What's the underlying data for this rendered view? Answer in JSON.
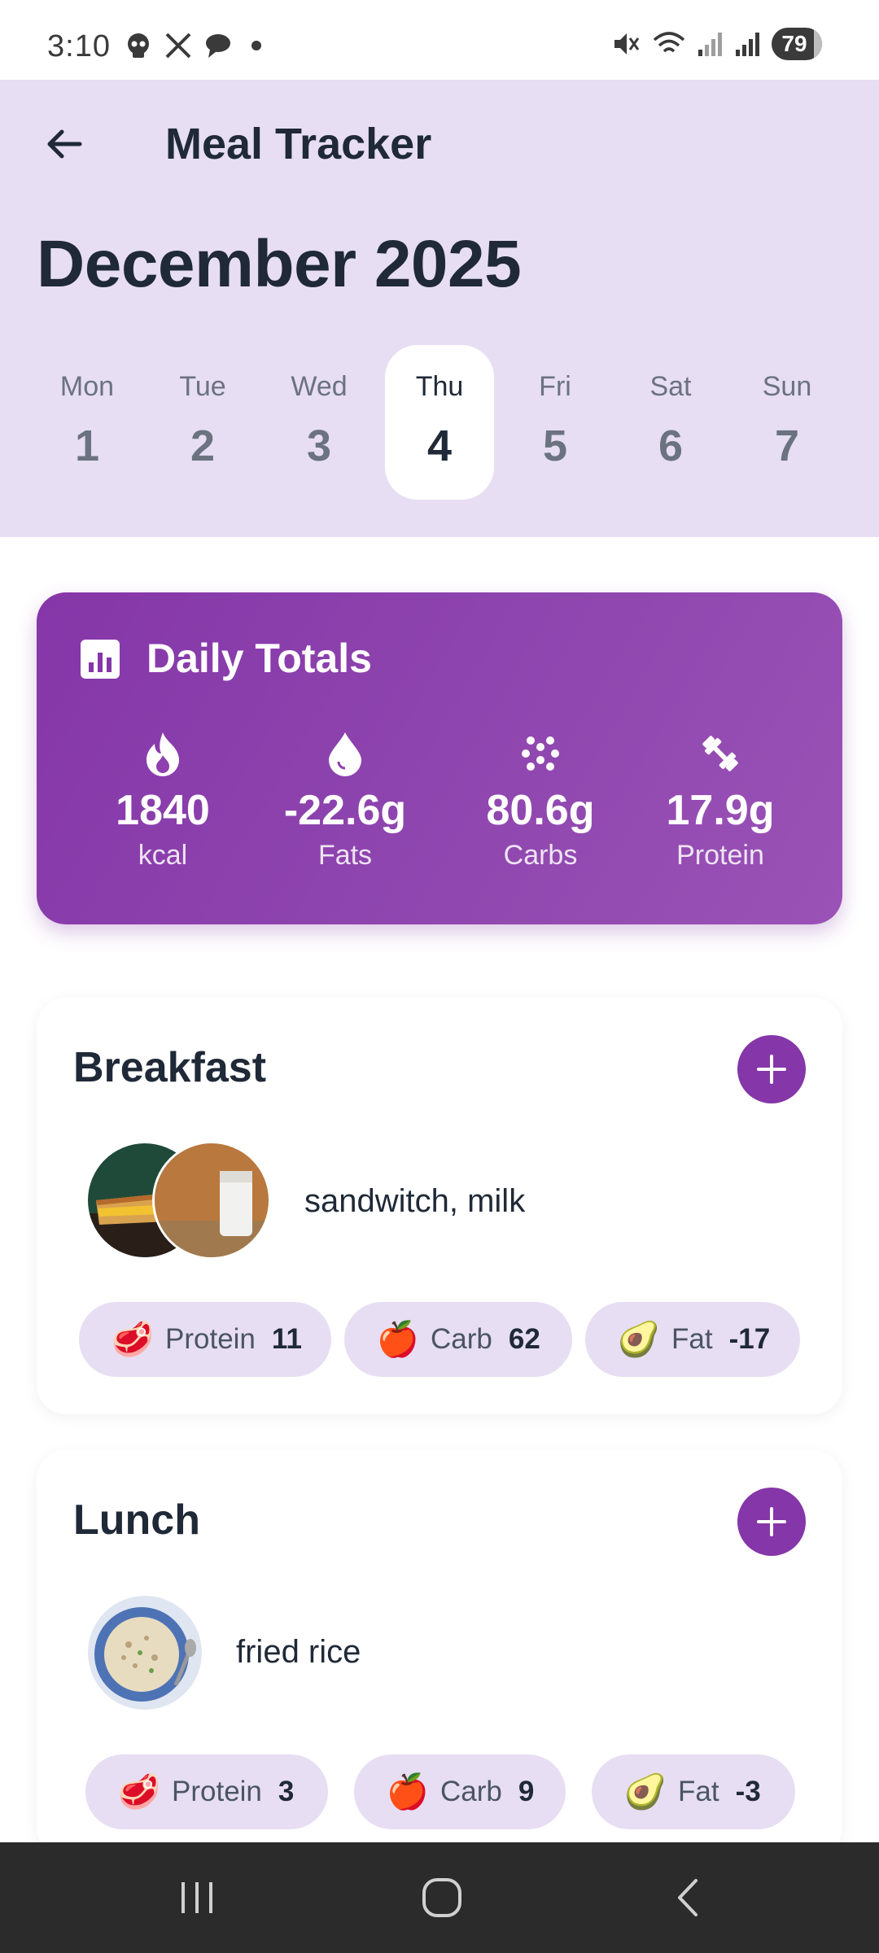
{
  "status_bar": {
    "time": "3:10",
    "battery": "79",
    "left_icons": [
      "skull-icon",
      "x-logo-icon",
      "chat-bubble-icon",
      "dot-icon"
    ],
    "right_icons": [
      "mute-icon",
      "wifi-icon",
      "signal-icon",
      "signal-icon",
      "battery-icon"
    ]
  },
  "header": {
    "title": "Meal Tracker",
    "month": "December 2025",
    "background": "#e7def3"
  },
  "week": {
    "days": [
      {
        "name": "Mon",
        "num": "1"
      },
      {
        "name": "Tue",
        "num": "2"
      },
      {
        "name": "Wed",
        "num": "3"
      },
      {
        "name": "Thu",
        "num": "4",
        "selected": true
      },
      {
        "name": "Fri",
        "num": "5"
      },
      {
        "name": "Sat",
        "num": "6"
      },
      {
        "name": "Sun",
        "num": "7"
      }
    ]
  },
  "totals": {
    "title": "Daily Totals",
    "accent": "#8536a8",
    "stats": [
      {
        "icon": "flame-icon",
        "value": "1840",
        "label": "kcal"
      },
      {
        "icon": "drop-icon",
        "value": "-22.6g",
        "label": "Fats"
      },
      {
        "icon": "grain-icon",
        "value": "80.6g",
        "label": "Carbs"
      },
      {
        "icon": "dumbbell-icon",
        "value": "17.9g",
        "label": "Protein"
      }
    ]
  },
  "meals": [
    {
      "title": "Breakfast",
      "foods": "sandwitch, milk",
      "chips": [
        {
          "emoji": "🥩",
          "label": "Protein",
          "value": "11"
        },
        {
          "emoji": "🍎",
          "label": "Carb",
          "value": "62"
        },
        {
          "emoji": "🥑",
          "label": "Fat",
          "value": "-17"
        }
      ]
    },
    {
      "title": "Lunch",
      "foods": "fried rice",
      "chips": [
        {
          "emoji": "🥩",
          "label": "Protein",
          "value": "3"
        },
        {
          "emoji": "🍎",
          "label": "Carb",
          "value": "9"
        },
        {
          "emoji": "🥑",
          "label": "Fat",
          "value": "-3"
        }
      ]
    }
  ]
}
